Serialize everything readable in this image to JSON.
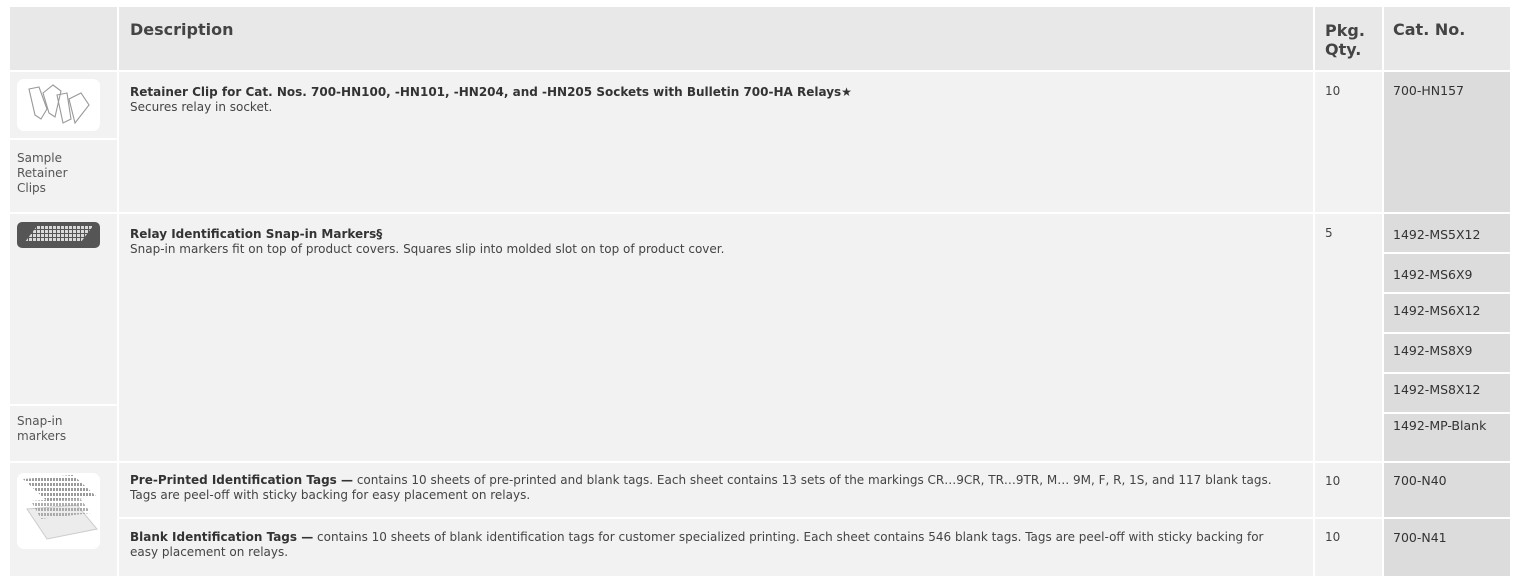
{
  "header": {
    "description": "Description",
    "pkg_qty": "Pkg. Qty.",
    "cat_no": "Cat. No."
  },
  "rows": [
    {
      "caption": "Sample Retainer Clips",
      "title": "Retainer Clip for Cat. Nos. 700-HN100, -HN101, -HN204, and -HN205 Sockets with Bulletin 700-HA Relays★",
      "desc": "Secures relay in socket.",
      "qty": "10",
      "cat_nos": [
        "700-HN157"
      ]
    },
    {
      "caption": "Snap-in markers",
      "title": "Relay Identification Snap-in Markers§",
      "desc": "Snap-in markers fit on top of product covers. Squares slip into molded slot on top of product cover.",
      "qty": "5",
      "cat_nos": [
        "1492-MS5X12",
        "1492-MS6X9",
        "1492-MS6X12",
        "1492-MS8X9",
        "1492-MS8X12",
        "1492-MP-Blank"
      ]
    },
    {
      "title": "Pre-Printed Identification Tags —",
      "desc": " contains 10 sheets of pre-printed and blank tags. Each sheet contains 13 sets of the markings CR…9CR, TR…9TR, M… 9M, F, R, 1S, and 117 blank tags. Tags are peel-off with sticky backing for easy placement on relays.",
      "qty": "10",
      "cat_nos": [
        "700-N40"
      ]
    },
    {
      "title": "Blank Identification Tags —",
      "desc": " contains 10 sheets of blank identification tags for customer specialized printing. Each sheet contains 546 blank tags. Tags are peel-off with sticky backing for easy placement on relays.",
      "qty": "10",
      "cat_nos": [
        "700-N41"
      ]
    }
  ],
  "icons": {
    "row1": "retainer-clip-image",
    "row2": "snap-in-marker-image",
    "row3": "identification-tags-image"
  },
  "colors": {
    "header_bg": "#e8e8e8",
    "cell_bg": "#f2f2f2",
    "cat_bg": "#dcdcdc"
  }
}
